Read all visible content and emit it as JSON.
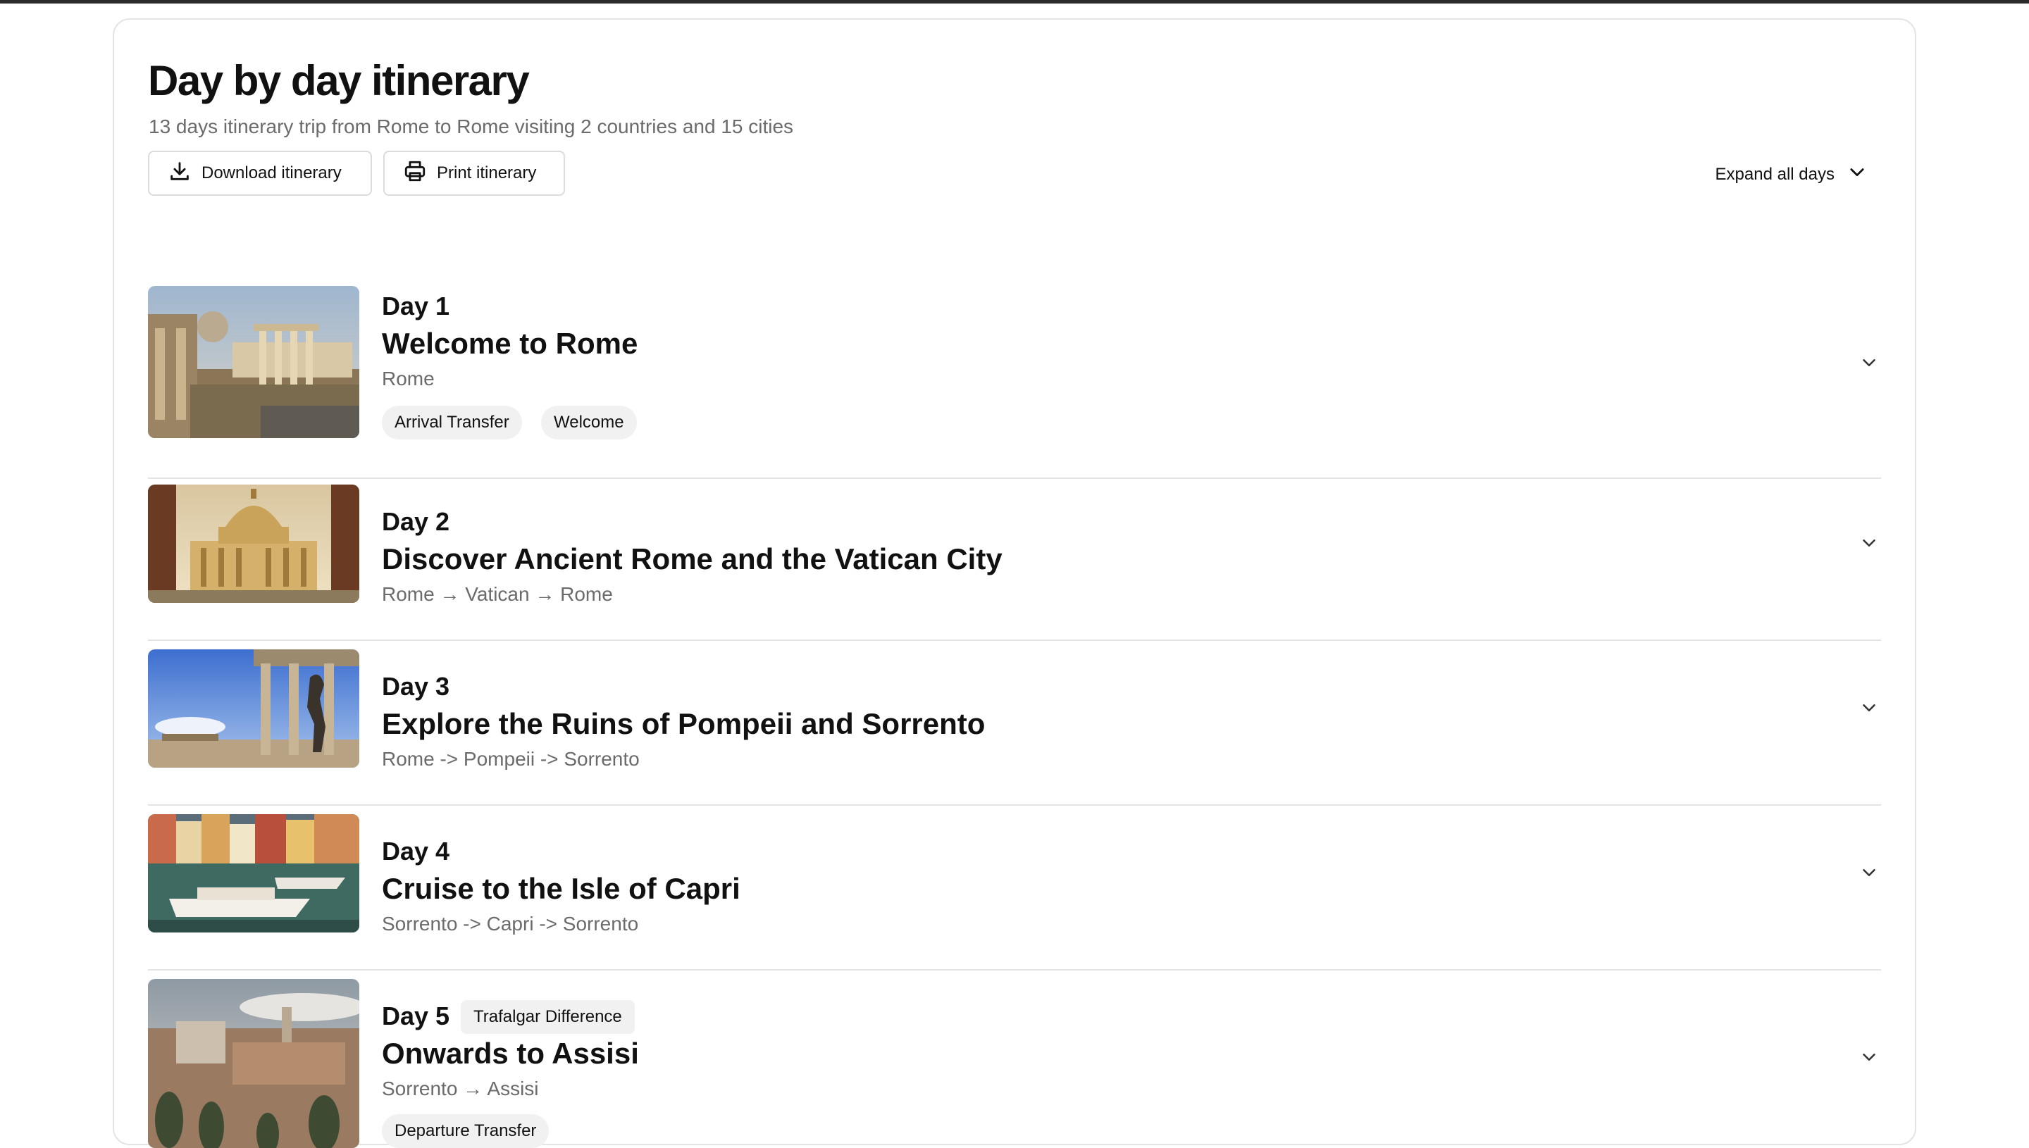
{
  "header": {
    "title": "Day by day itinerary",
    "subtitle": "13 days itinerary trip from Rome to Rome visiting 2 countries and 15 cities",
    "download_label": "Download itinerary",
    "print_label": "Print itinerary",
    "expand_label": "Expand all days"
  },
  "days": [
    {
      "day_label": "Day 1",
      "title": "Welcome to Rome",
      "route": "Rome",
      "tags": [
        "Arrival Transfer",
        "Welcome"
      ],
      "image": "roman-forum-ruins"
    },
    {
      "day_label": "Day 2",
      "title": "Discover Ancient Rome and the Vatican City",
      "route": "Rome → Vatican → Rome",
      "tags": [],
      "image": "st-peters-basilica"
    },
    {
      "day_label": "Day 3",
      "title": "Explore the Ruins of Pompeii and Sorrento",
      "route": "Rome -> Pompeii -> Sorrento",
      "tags": [],
      "image": "pompeii-statue-columns"
    },
    {
      "day_label": "Day 4",
      "title": "Cruise to the Isle of Capri",
      "route": "Sorrento -> Capri -> Sorrento",
      "tags": [],
      "image": "capri-harbour-boats"
    },
    {
      "day_label": "Day 5",
      "badge": "Trafalgar Difference",
      "title": "Onwards to Assisi",
      "route": "Sorrento → Assisi",
      "tags": [
        "Departure Transfer"
      ],
      "image": "assisi-hilltown"
    }
  ],
  "icons": {
    "download": "download-icon",
    "print": "printer-icon",
    "chevron": "chevron-down-icon"
  },
  "colors": {
    "text": "#111111",
    "muted": "#6b6b6b",
    "border": "#e4e4e4",
    "tag_bg": "#f1f1f1"
  }
}
